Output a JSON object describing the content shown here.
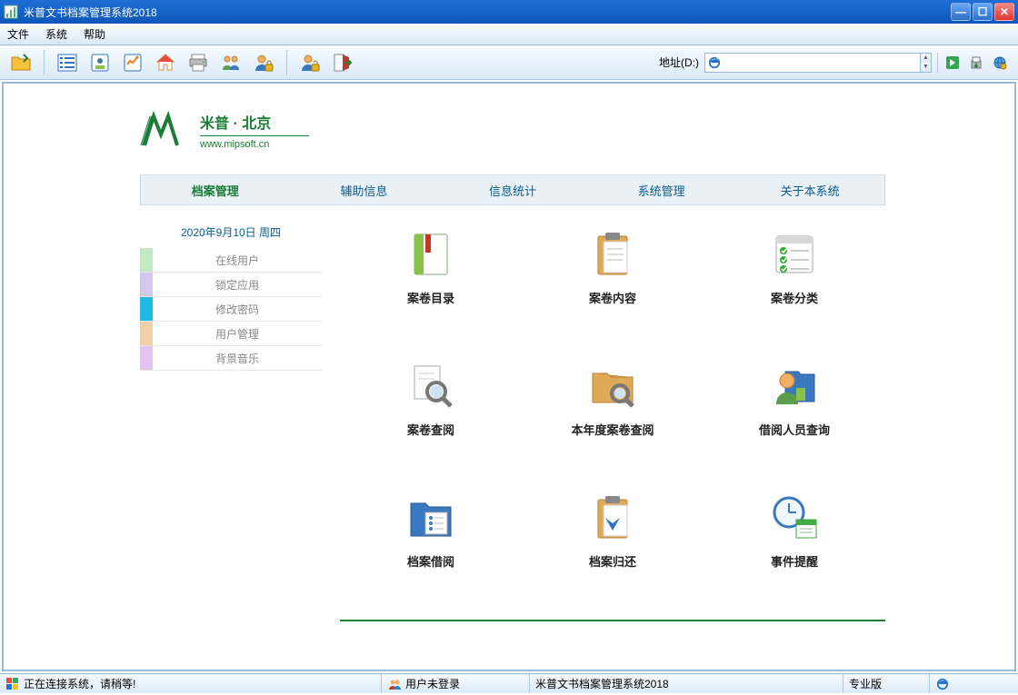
{
  "window": {
    "title": "米普文书档案管理系统2018"
  },
  "menu": {
    "file": "文件",
    "system": "系统",
    "help": "帮助"
  },
  "toolbar": {
    "address_label": "地址(D:)",
    "address_value": ""
  },
  "brand": {
    "name": "米普 · 北京",
    "url": "www.mipsoft.cn"
  },
  "tabs": {
    "t0": "档案管理",
    "t1": "辅助信息",
    "t2": "信息统计",
    "t3": "系统管理",
    "t4": "关于本系统"
  },
  "sidebar": {
    "date": "2020年9月10日  周四",
    "items": {
      "i0": {
        "label": "在线用户",
        "color": "#c5e8c4"
      },
      "i1": {
        "label": "锁定应用",
        "color": "#d2c8ee"
      },
      "i2": {
        "label": "修改密码",
        "color": "#1fb8e0"
      },
      "i3": {
        "label": "用户管理",
        "color": "#efd0a9"
      },
      "i4": {
        "label": "背景音乐",
        "color": "#e3c4ef"
      }
    }
  },
  "main": {
    "m0": "案卷目录",
    "m1": "案卷内容",
    "m2": "案卷分类",
    "m3": "案卷查阅",
    "m4": "本年度案卷查阅",
    "m5": "借阅人员查询",
    "m6": "档案借阅",
    "m7": "档案归还",
    "m8": "事件提醒"
  },
  "status": {
    "connecting": "正在连接系统，请稍等!",
    "login": "用户未登录",
    "app": "米普文书档案管理系统2018",
    "edition": "专业版"
  }
}
